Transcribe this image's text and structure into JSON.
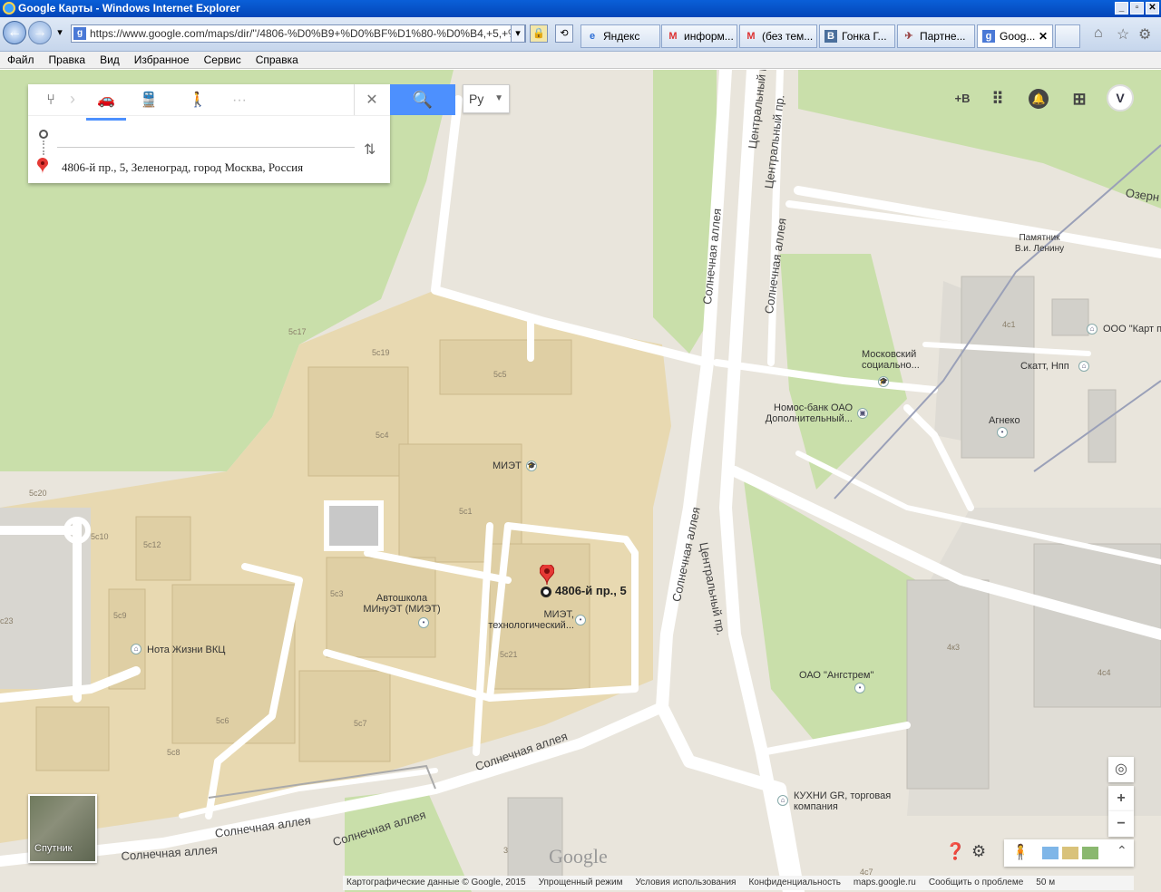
{
  "window": {
    "title": "Google Карты - Windows Internet Explorer"
  },
  "address": {
    "url": "https://www.google.com/maps/dir/''/4806-%D0%B9+%D0%BF%D1%80-%D0%B4,+5,+%"
  },
  "tabs": [
    {
      "label": "Яндекс"
    },
    {
      "label": "информ..."
    },
    {
      "label": "(без тем..."
    },
    {
      "label": "Гонка Г..."
    },
    {
      "label": "Партне..."
    },
    {
      "label": "Goog..."
    }
  ],
  "menu": [
    "Файл",
    "Правка",
    "Вид",
    "Избранное",
    "Сервис",
    "Справка"
  ],
  "directions": {
    "origin_placeholder": "",
    "destination": "4806-й пр., 5, Зеленоград, город Москва, Россия",
    "more": "···"
  },
  "lang": "Ру",
  "account": {
    "plus": "+В"
  },
  "map": {
    "marker_label": "4806-й пр., 5",
    "places": [
      "Памятник В.и. Ленину",
      "Московский социально...",
      "Номос-банк ОАО Дополнительный...",
      "Скатт, Нпп",
      "Агнеко",
      "ООО \"Карт п",
      "МИЭТ",
      "Автошкола МИнуЭТ (МИЭТ)",
      "МИЭТ, технологический...",
      "Нота Жизни ВКЦ",
      "ОАО \"Ангстрем\"",
      "КУХНИ GR, торговая компания"
    ],
    "streets": [
      "Центральный пр.",
      "Солнечная аллея",
      "Озерн"
    ],
    "buildings": [
      "5с17",
      "5с19",
      "5с5",
      "5с4",
      "5с1",
      "5с20",
      "5с10",
      "5с12",
      "5с9",
      "5с3",
      "5с21",
      "5с6",
      "5с7",
      "5с8",
      "4с1",
      "4к3",
      "4с4",
      "3",
      "4с7",
      "с23"
    ],
    "satellite_label": "Спутник",
    "logo": "Google"
  },
  "footer": [
    "Картографические данные © Google, 2015",
    "Упрощенный режим",
    "Условия использования",
    "Конфиденциальность",
    "maps.google.ru",
    "Сообщить о проблеме",
    "50 м"
  ]
}
